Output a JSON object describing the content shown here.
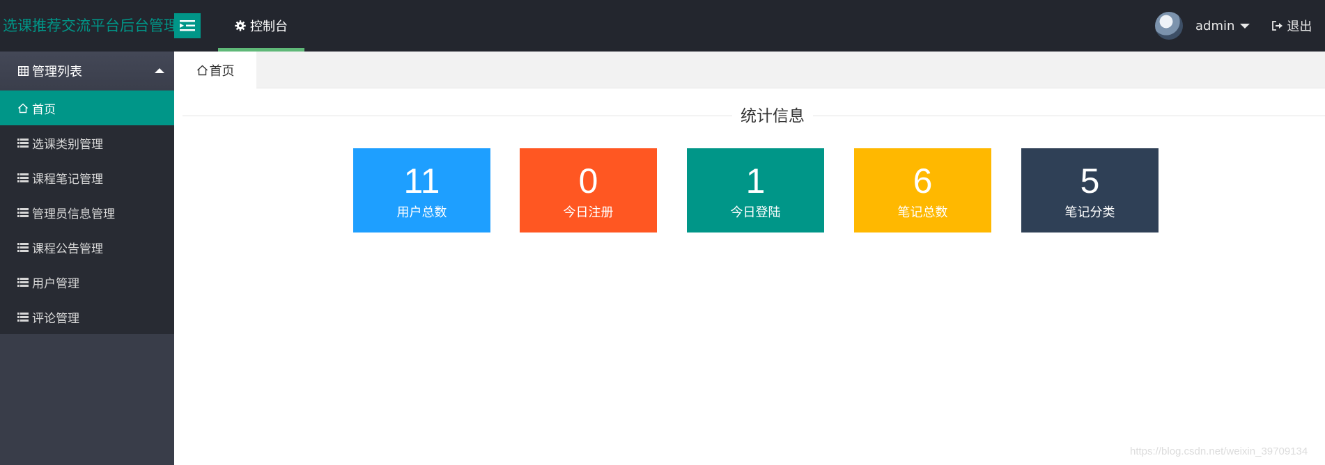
{
  "header": {
    "brand": "选课推荐交流平台后台管理",
    "console_label": "控制台",
    "username": "admin",
    "logout_label": "退出"
  },
  "sidebar": {
    "group_label": "管理列表",
    "items": [
      {
        "label": "首页",
        "icon": "home-icon",
        "active": true
      },
      {
        "label": "选课类别管理",
        "icon": "list-icon"
      },
      {
        "label": "课程笔记管理",
        "icon": "list-icon"
      },
      {
        "label": "管理员信息管理",
        "icon": "list-icon"
      },
      {
        "label": "课程公告管理",
        "icon": "list-icon"
      },
      {
        "label": "用户管理",
        "icon": "list-icon"
      },
      {
        "label": "评论管理",
        "icon": "list-icon"
      }
    ]
  },
  "tabs": [
    {
      "label": "首页",
      "icon": "home-icon"
    }
  ],
  "stats": {
    "title": "统计信息",
    "cards": [
      {
        "value": "11",
        "label": "用户总数",
        "color": "#1e9fff"
      },
      {
        "value": "0",
        "label": "今日注册",
        "color": "#ff5722"
      },
      {
        "value": "1",
        "label": "今日登陆",
        "color": "#009688"
      },
      {
        "value": "6",
        "label": "笔记总数",
        "color": "#ffb800"
      },
      {
        "value": "5",
        "label": "笔记分类",
        "color": "#2f4056"
      }
    ]
  },
  "watermark": "https://blog.csdn.net/weixin_39709134",
  "colors": {
    "header_bg": "#23262e",
    "sidebar_bg": "#393d49",
    "accent": "#009688",
    "active_underline": "#5fb878"
  }
}
